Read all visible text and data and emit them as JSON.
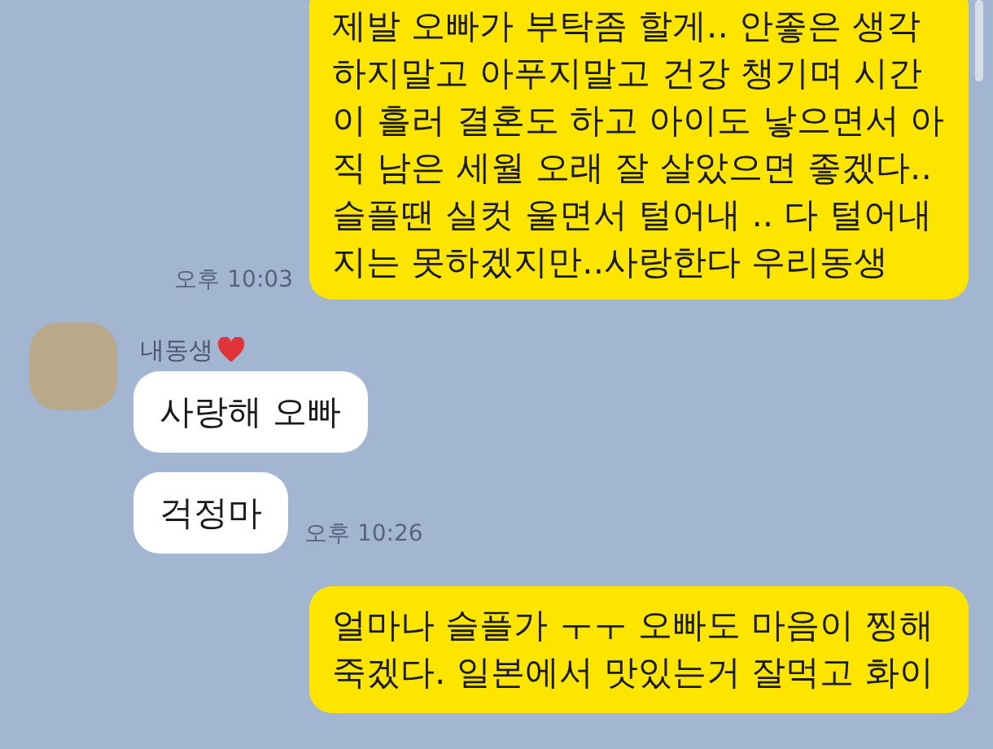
{
  "messages": [
    {
      "kind": "sent",
      "text": "제발 오빠가 부탁좀 할게.. 안좋은 생각 하지말고 아푸지말고 건강 챙기며 시간 이 흘러 결혼도 하고 아이도 낳으면서 아 직 남은 세월 오래 잘 살았으면 좋겠다.. 슬플땐 실컷 울면서 털어내 .. 다 털어내 지는 못하겠지만..사랑한다 우리동생",
      "time": "오후 10:03"
    },
    {
      "kind": "sender",
      "name": "내동생"
    },
    {
      "kind": "received",
      "text": "사랑해 오빠"
    },
    {
      "kind": "received",
      "text": "걱정마",
      "time": "오후 10:26"
    },
    {
      "kind": "sent",
      "text": "얼마나 슬플가 ㅜㅜ 오빠도 마음이 찡해 죽겠다. 일본에서 맛있는거 잘먹고 화이"
    }
  ]
}
